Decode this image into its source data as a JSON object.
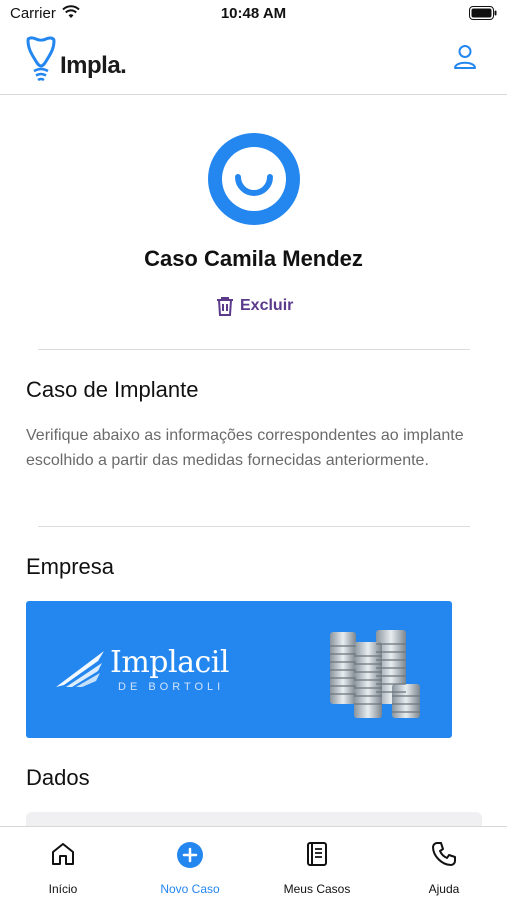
{
  "status_bar": {
    "carrier": "Carrier",
    "time": "10:48 AM"
  },
  "header": {
    "logo_text": "Impla.",
    "profile_icon": "user-icon"
  },
  "case": {
    "title": "Caso Camila Mendez",
    "delete_label": "Excluir"
  },
  "implant_section": {
    "heading": "Caso de Implante",
    "description": "Verifique abaixo as informações correspondentes ao implante escolhido a partir das medidas fornecidas anteriormente."
  },
  "company_section": {
    "heading": "Empresa",
    "brand_name": "Implacil",
    "brand_sub": "DE BORTOLI"
  },
  "data_section": {
    "heading": "Dados"
  },
  "tabs": [
    {
      "label": "Início",
      "icon": "home-icon",
      "active": false
    },
    {
      "label": "Novo Caso",
      "icon": "plus-circle-icon",
      "active": true
    },
    {
      "label": "Meus Casos",
      "icon": "book-icon",
      "active": false
    },
    {
      "label": "Ajuda",
      "icon": "phone-icon",
      "active": false
    }
  ],
  "colors": {
    "accent": "#2487f0",
    "danger_text": "#5b3a8c",
    "muted_text": "#6a6a6a"
  }
}
